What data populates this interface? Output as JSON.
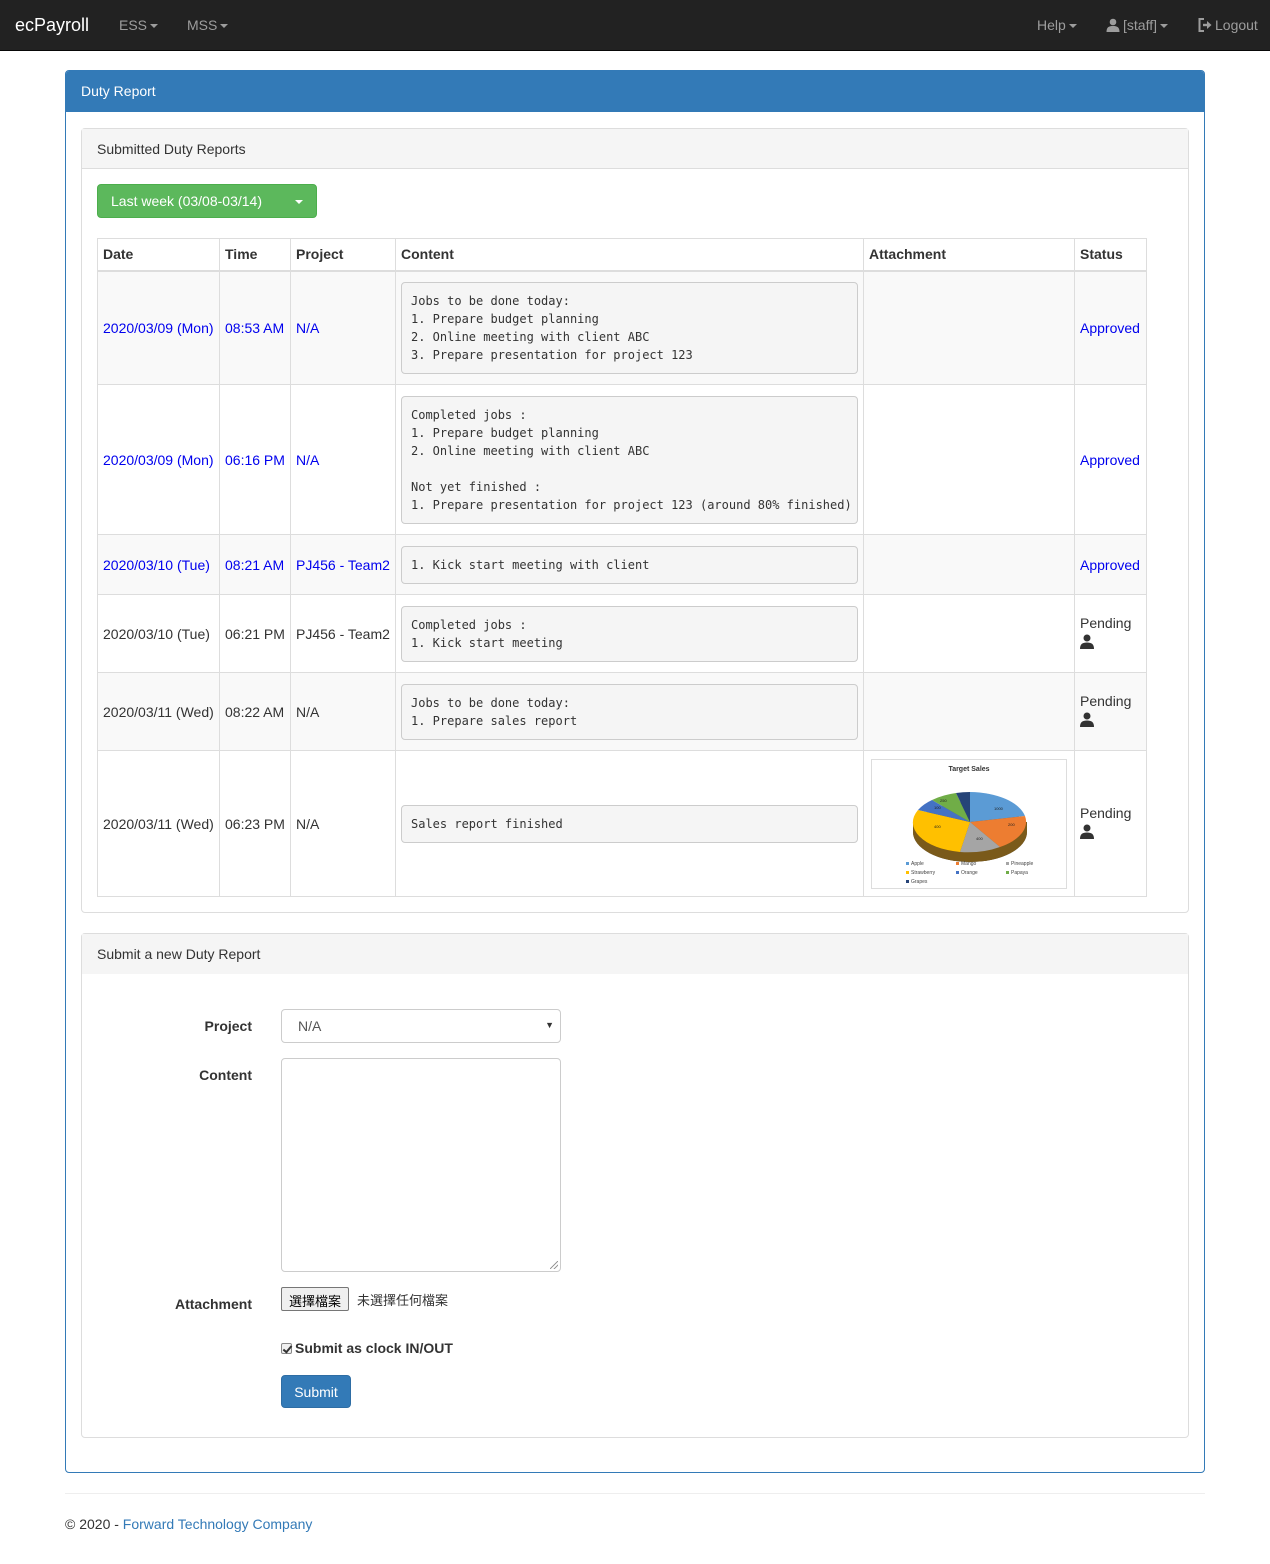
{
  "nav": {
    "brand": "ecPayroll",
    "ess": "ESS",
    "mss": "MSS",
    "help": "Help",
    "user": "[staff]",
    "logout": "Logout"
  },
  "panel": {
    "title": "Duty Report"
  },
  "submitted": {
    "heading": "Submitted Duty Reports",
    "week_selector": "Last week (03/08-03/14)",
    "columns": [
      "Date",
      "Time",
      "Project",
      "Content",
      "Attachment",
      "Status"
    ],
    "rows": [
      {
        "date": "2020/03/09 (Mon)",
        "time": "08:53 AM",
        "project": "N/A",
        "content": "Jobs to be done today:\n1. Prepare budget planning\n2. Online meeting with client ABC\n3. Prepare presentation for project 123",
        "status": "Approved"
      },
      {
        "date": "2020/03/09 (Mon)",
        "time": "06:16 PM",
        "project": "N/A",
        "content": "Completed jobs :\n1. Prepare budget planning\n2. Online meeting with client ABC\n\nNot yet finished :\n1. Prepare presentation for project 123 (around 80% finished)",
        "status": "Approved"
      },
      {
        "date": "2020/03/10 (Tue)",
        "time": "08:21 AM",
        "project": "PJ456 - Team2",
        "content": "1. Kick start meeting with client",
        "status": "Approved"
      },
      {
        "date": "2020/03/10 (Tue)",
        "time": "06:21 PM",
        "project": "PJ456 - Team2",
        "content": "Completed jobs :\n1. Kick start meeting",
        "status": "Pending"
      },
      {
        "date": "2020/03/11 (Wed)",
        "time": "08:22 AM",
        "project": "N/A",
        "content": "Jobs to be done today:\n1. Prepare sales report",
        "status": "Pending"
      },
      {
        "date": "2020/03/11 (Wed)",
        "time": "06:23 PM",
        "project": "N/A",
        "content": "Sales report finished",
        "status": "Pending"
      }
    ],
    "attachment_chart": {
      "title": "Target Sales",
      "labels": [
        "1000",
        "250",
        "100",
        "400",
        "200",
        "400"
      ],
      "legend": [
        "Apple",
        "Mango",
        "Pineapple",
        "Strawberry",
        "Orange",
        "Papaya",
        "Grapes"
      ],
      "colors": [
        "#5b9bd5",
        "#ed7d31",
        "#a5a5a5",
        "#ffc000",
        "#4472c4",
        "#70ad47",
        "#264478"
      ]
    }
  },
  "form": {
    "heading": "Submit a new Duty Report",
    "project_label": "Project",
    "project_value": "N/A",
    "content_label": "Content",
    "attachment_label": "Attachment",
    "file_button": "選擇檔案",
    "file_none": "未選擇任何檔案",
    "clock_label": "Submit as clock IN/OUT",
    "submit": "Submit"
  },
  "footer": {
    "prefix": "© 2020 - ",
    "company": "Forward Technology Company"
  },
  "colors": {
    "navbar": "#222222",
    "primary": "#337ab7",
    "success": "#5cb85c",
    "approved_link": "#0000ee"
  }
}
